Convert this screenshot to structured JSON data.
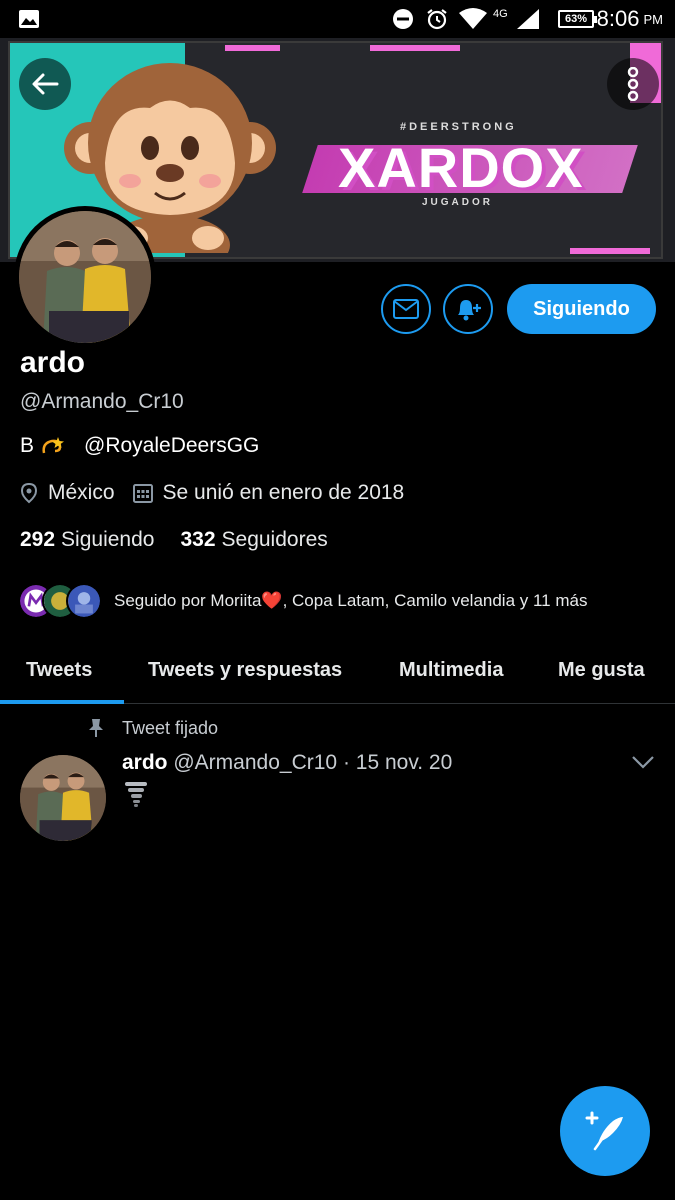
{
  "status_bar": {
    "time": "8:06",
    "ampm": "PM",
    "battery": "63%",
    "network": "4G",
    "icons": [
      "gallery-icon",
      "do-not-disturb-icon",
      "alarm-icon",
      "wifi-icon",
      "signal-icon",
      "battery-icon"
    ]
  },
  "banner": {
    "tagline": "#DEERSTRONG",
    "title": "XARDOX",
    "subtitle": "JUGADOR",
    "colors": {
      "teal": "#25c6b9",
      "pink": "#e040c9",
      "dark": "#26272c"
    }
  },
  "profile": {
    "name": "ardo",
    "handle": "@Armando_Cr10",
    "bio_prefix": "B",
    "bio_mention": "@RoyaleDeersGG",
    "location": "México",
    "joined": "Se unió en enero de 2018",
    "following_count": "292",
    "following_label": "Siguiendo",
    "followers_count": "332",
    "followers_label": "Seguidores",
    "follow_button": "Siguiendo",
    "followed_by": "Seguido por Moriita❤️, Copa Latam, Camilo velandia y 11 más"
  },
  "tabs": [
    {
      "label": "Tweets",
      "active": true
    },
    {
      "label": "Tweets y respuestas",
      "active": false
    },
    {
      "label": "Multimedia",
      "active": false
    },
    {
      "label": "Me gusta",
      "active": false
    }
  ],
  "pinned_tweet": {
    "pinned_label": "Tweet fijado",
    "author_name": "ardo",
    "author_handle": "@Armando_Cr10",
    "date": "· 15 nov. 20",
    "content_icon": "tornado-emoji"
  },
  "accent": "#1d9bf0"
}
